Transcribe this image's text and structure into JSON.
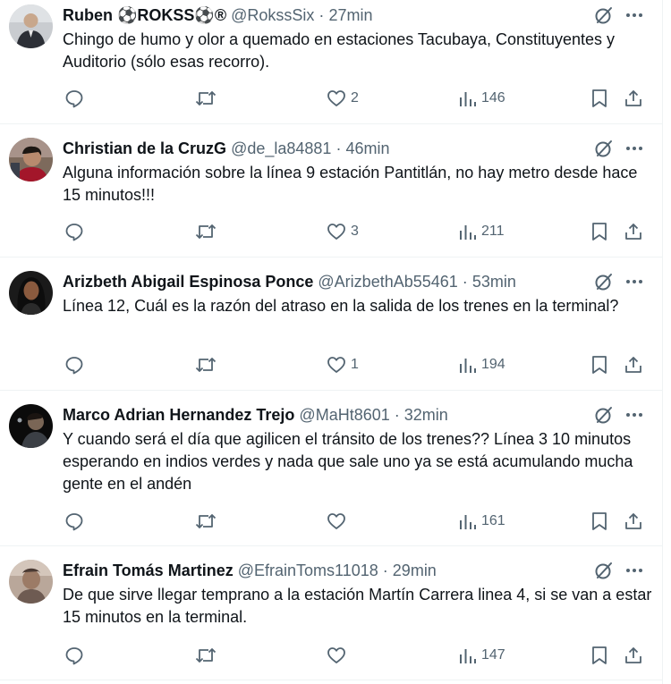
{
  "colors": {
    "text": "#0f1419",
    "secondary": "#536471",
    "divider": "#eff3f4"
  },
  "tweets": [
    {
      "name": "Ruben ⚽ROKSS⚽®",
      "handle": "@RokssSix",
      "time": "27min",
      "text": "Chingo de humo y olor a quemado en estaciones Tacubaya, Constituyentes y Auditorio (sólo esas recorro).",
      "replies": "",
      "retweets": "",
      "likes": "2",
      "views": "146",
      "avatar_icon": "profile-photo-man-dark-suit"
    },
    {
      "name": "Christian de la CruzG",
      "handle": "@de_la84881",
      "time": "46min",
      "text": "Alguna información sobre la línea 9 estación Pantitlán, no hay metro desde hace 15 minutos!!!",
      "replies": "",
      "retweets": "",
      "likes": "3",
      "views": "211",
      "avatar_icon": "profile-photo-man-selfie"
    },
    {
      "name": "Arizbeth Abigail Espinosa Ponce",
      "handle": "@ArizbethAb55461",
      "time": "53min",
      "text": "Línea 12, Cuál es la razón del atraso en la salida de los trenes en la terminal?",
      "replies": "",
      "retweets": "",
      "likes": "1",
      "views": "194",
      "avatar_icon": "profile-photo-woman-dark-hair"
    },
    {
      "name": "Marco Adrian Hernandez Trejo",
      "handle": "@MaHt8601",
      "time": "32min",
      "text": "Y cuando será el día que agilicen el tránsito de los trenes?? Línea 3 10 minutos esperando en indios verdes y nada que sale uno ya se está acumulando mucha gente en el andén",
      "replies": "",
      "retweets": "",
      "likes": "",
      "views": "161",
      "avatar_icon": "profile-photo-man-dark-background"
    },
    {
      "name": "Efrain Tomás Martinez",
      "handle": "@EfrainToms11018",
      "time": "29min",
      "text": "De que sirve llegar temprano a la estación Martín Carrera linea 4, si se van a estar 15 minutos en la terminal.",
      "replies": "",
      "retweets": "",
      "likes": "",
      "views": "147",
      "avatar_icon": "profile-photo-man-blurry"
    }
  ],
  "actions": {
    "reply_icon": "reply-icon",
    "retweet_icon": "retweet-icon",
    "like_icon": "heart-icon",
    "views_icon": "views-chart-icon",
    "bookmark_icon": "bookmark-icon",
    "share_icon": "share-icon",
    "grok_icon": "grok-icon",
    "more_icon": "more-dots-icon"
  }
}
